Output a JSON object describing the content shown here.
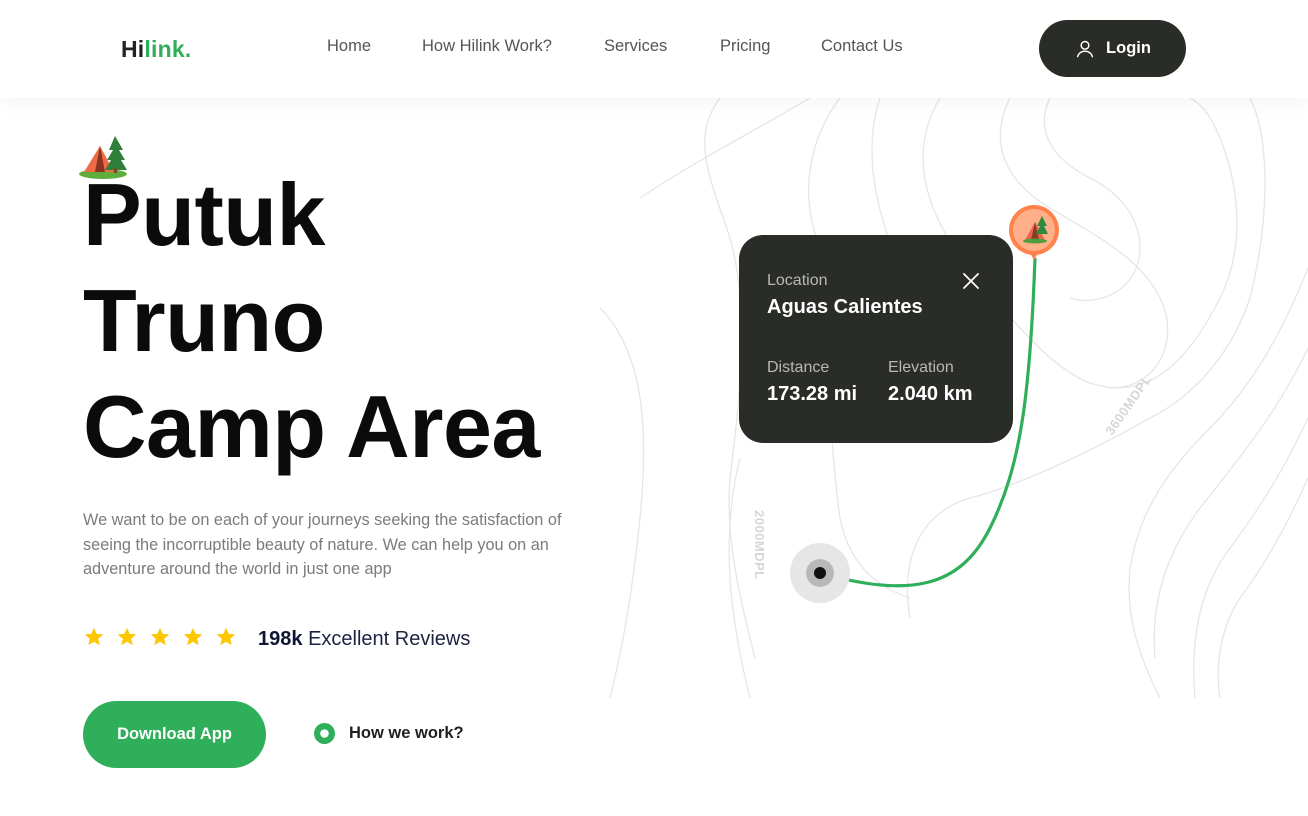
{
  "header": {
    "logo_hi": "Hi",
    "logo_link": "link.",
    "nav": [
      "Home",
      "How Hilink Work?",
      "Services",
      "Pricing",
      "Contact Us"
    ],
    "login_label": "Login"
  },
  "hero": {
    "title_lines": [
      "Putuk",
      "Truno",
      "Camp Area"
    ],
    "description": "We want to be on each of your journeys seeking the satisfaction of seeing the incorruptible beauty of nature. We can help you on an adventure around the world in just one app",
    "rating_stars": 5,
    "reviews_count": "198k",
    "reviews_label": "Excellent Reviews",
    "download_label": "Download App",
    "how_work_label": "How we work?"
  },
  "map": {
    "altitude_labels": [
      "2000MDPL",
      "3600MDPL"
    ],
    "card": {
      "location_label": "Location",
      "location_value": "Aguas Calientes",
      "distance_label": "Distance",
      "distance_value": "173.28 mi",
      "elevation_label": "Elevation",
      "elevation_value": "2.040 km"
    }
  },
  "colors": {
    "brand_green": "#30af5b",
    "dark": "#292c27",
    "star": "#fec601",
    "pin_orange": "#ff814c"
  },
  "icons": {
    "login": "user-icon",
    "close": "close-icon",
    "play": "play-icon",
    "star": "star-icon",
    "tent": "camp-icon"
  }
}
